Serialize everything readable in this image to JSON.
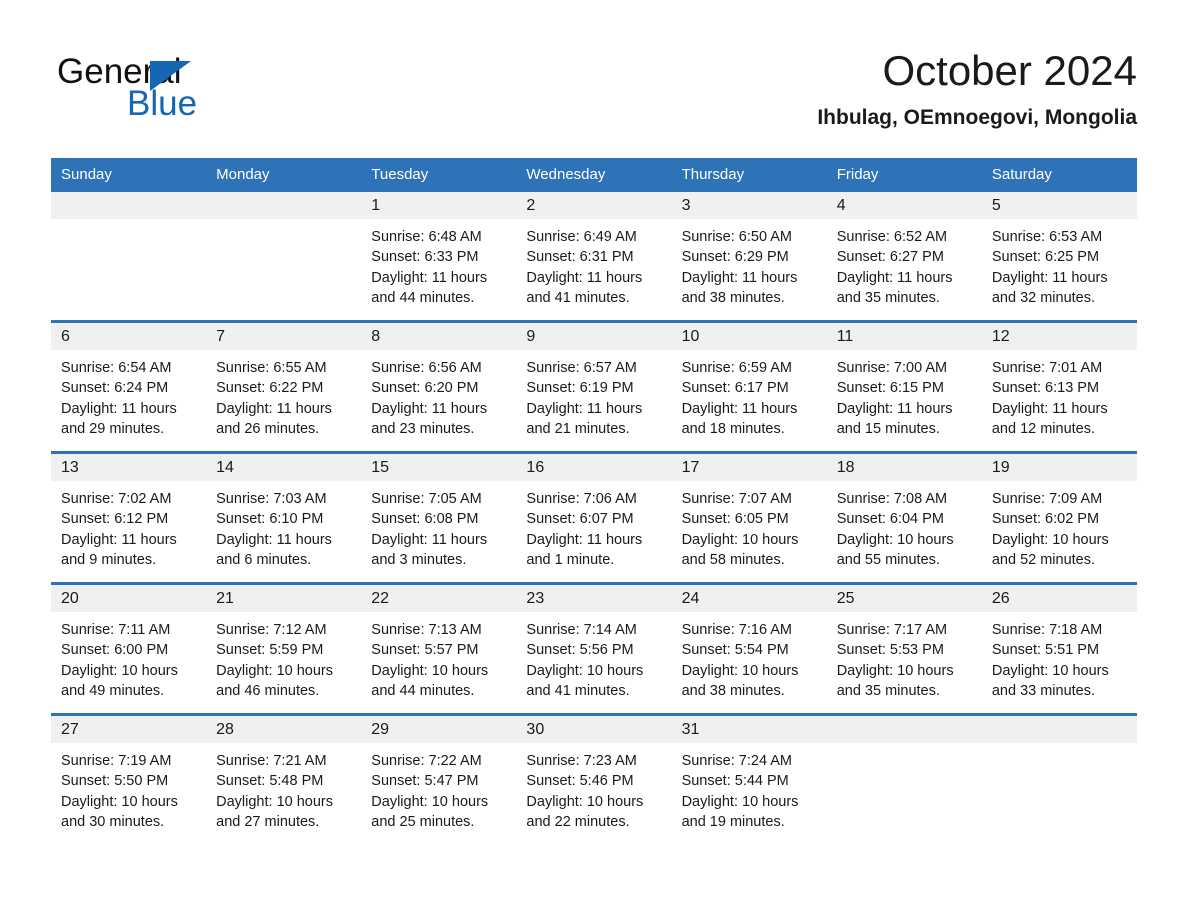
{
  "brand": {
    "name_part1": "General",
    "name_part2": "Blue",
    "logo_icon": "triangle-flag-icon",
    "accent_color": "#1567b2"
  },
  "header": {
    "title": "October 2024",
    "location": "Ihbulag, OEmnoegovi, Mongolia"
  },
  "colors": {
    "header_blue": "#2e73b8",
    "daynum_band": "#f0f0f0",
    "text": "#1a1a1a"
  },
  "calendar": {
    "weekday_headers": [
      "Sunday",
      "Monday",
      "Tuesday",
      "Wednesday",
      "Thursday",
      "Friday",
      "Saturday"
    ],
    "weeks": [
      [
        {
          "day": "",
          "empty": true
        },
        {
          "day": "",
          "empty": true
        },
        {
          "day": "1",
          "sunrise": "Sunrise: 6:48 AM",
          "sunset": "Sunset: 6:33 PM",
          "daylight": "Daylight: 11 hours and 44 minutes."
        },
        {
          "day": "2",
          "sunrise": "Sunrise: 6:49 AM",
          "sunset": "Sunset: 6:31 PM",
          "daylight": "Daylight: 11 hours and 41 minutes."
        },
        {
          "day": "3",
          "sunrise": "Sunrise: 6:50 AM",
          "sunset": "Sunset: 6:29 PM",
          "daylight": "Daylight: 11 hours and 38 minutes."
        },
        {
          "day": "4",
          "sunrise": "Sunrise: 6:52 AM",
          "sunset": "Sunset: 6:27 PM",
          "daylight": "Daylight: 11 hours and 35 minutes."
        },
        {
          "day": "5",
          "sunrise": "Sunrise: 6:53 AM",
          "sunset": "Sunset: 6:25 PM",
          "daylight": "Daylight: 11 hours and 32 minutes."
        }
      ],
      [
        {
          "day": "6",
          "sunrise": "Sunrise: 6:54 AM",
          "sunset": "Sunset: 6:24 PM",
          "daylight": "Daylight: 11 hours and 29 minutes."
        },
        {
          "day": "7",
          "sunrise": "Sunrise: 6:55 AM",
          "sunset": "Sunset: 6:22 PM",
          "daylight": "Daylight: 11 hours and 26 minutes."
        },
        {
          "day": "8",
          "sunrise": "Sunrise: 6:56 AM",
          "sunset": "Sunset: 6:20 PM",
          "daylight": "Daylight: 11 hours and 23 minutes."
        },
        {
          "day": "9",
          "sunrise": "Sunrise: 6:57 AM",
          "sunset": "Sunset: 6:19 PM",
          "daylight": "Daylight: 11 hours and 21 minutes."
        },
        {
          "day": "10",
          "sunrise": "Sunrise: 6:59 AM",
          "sunset": "Sunset: 6:17 PM",
          "daylight": "Daylight: 11 hours and 18 minutes."
        },
        {
          "day": "11",
          "sunrise": "Sunrise: 7:00 AM",
          "sunset": "Sunset: 6:15 PM",
          "daylight": "Daylight: 11 hours and 15 minutes."
        },
        {
          "day": "12",
          "sunrise": "Sunrise: 7:01 AM",
          "sunset": "Sunset: 6:13 PM",
          "daylight": "Daylight: 11 hours and 12 minutes."
        }
      ],
      [
        {
          "day": "13",
          "sunrise": "Sunrise: 7:02 AM",
          "sunset": "Sunset: 6:12 PM",
          "daylight": "Daylight: 11 hours and 9 minutes."
        },
        {
          "day": "14",
          "sunrise": "Sunrise: 7:03 AM",
          "sunset": "Sunset: 6:10 PM",
          "daylight": "Daylight: 11 hours and 6 minutes."
        },
        {
          "day": "15",
          "sunrise": "Sunrise: 7:05 AM",
          "sunset": "Sunset: 6:08 PM",
          "daylight": "Daylight: 11 hours and 3 minutes."
        },
        {
          "day": "16",
          "sunrise": "Sunrise: 7:06 AM",
          "sunset": "Sunset: 6:07 PM",
          "daylight": "Daylight: 11 hours and 1 minute."
        },
        {
          "day": "17",
          "sunrise": "Sunrise: 7:07 AM",
          "sunset": "Sunset: 6:05 PM",
          "daylight": "Daylight: 10 hours and 58 minutes."
        },
        {
          "day": "18",
          "sunrise": "Sunrise: 7:08 AM",
          "sunset": "Sunset: 6:04 PM",
          "daylight": "Daylight: 10 hours and 55 minutes."
        },
        {
          "day": "19",
          "sunrise": "Sunrise: 7:09 AM",
          "sunset": "Sunset: 6:02 PM",
          "daylight": "Daylight: 10 hours and 52 minutes."
        }
      ],
      [
        {
          "day": "20",
          "sunrise": "Sunrise: 7:11 AM",
          "sunset": "Sunset: 6:00 PM",
          "daylight": "Daylight: 10 hours and 49 minutes."
        },
        {
          "day": "21",
          "sunrise": "Sunrise: 7:12 AM",
          "sunset": "Sunset: 5:59 PM",
          "daylight": "Daylight: 10 hours and 46 minutes."
        },
        {
          "day": "22",
          "sunrise": "Sunrise: 7:13 AM",
          "sunset": "Sunset: 5:57 PM",
          "daylight": "Daylight: 10 hours and 44 minutes."
        },
        {
          "day": "23",
          "sunrise": "Sunrise: 7:14 AM",
          "sunset": "Sunset: 5:56 PM",
          "daylight": "Daylight: 10 hours and 41 minutes."
        },
        {
          "day": "24",
          "sunrise": "Sunrise: 7:16 AM",
          "sunset": "Sunset: 5:54 PM",
          "daylight": "Daylight: 10 hours and 38 minutes."
        },
        {
          "day": "25",
          "sunrise": "Sunrise: 7:17 AM",
          "sunset": "Sunset: 5:53 PM",
          "daylight": "Daylight: 10 hours and 35 minutes."
        },
        {
          "day": "26",
          "sunrise": "Sunrise: 7:18 AM",
          "sunset": "Sunset: 5:51 PM",
          "daylight": "Daylight: 10 hours and 33 minutes."
        }
      ],
      [
        {
          "day": "27",
          "sunrise": "Sunrise: 7:19 AM",
          "sunset": "Sunset: 5:50 PM",
          "daylight": "Daylight: 10 hours and 30 minutes."
        },
        {
          "day": "28",
          "sunrise": "Sunrise: 7:21 AM",
          "sunset": "Sunset: 5:48 PM",
          "daylight": "Daylight: 10 hours and 27 minutes."
        },
        {
          "day": "29",
          "sunrise": "Sunrise: 7:22 AM",
          "sunset": "Sunset: 5:47 PM",
          "daylight": "Daylight: 10 hours and 25 minutes."
        },
        {
          "day": "30",
          "sunrise": "Sunrise: 7:23 AM",
          "sunset": "Sunset: 5:46 PM",
          "daylight": "Daylight: 10 hours and 22 minutes."
        },
        {
          "day": "31",
          "sunrise": "Sunrise: 7:24 AM",
          "sunset": "Sunset: 5:44 PM",
          "daylight": "Daylight: 10 hours and 19 minutes."
        },
        {
          "day": "",
          "empty": true
        },
        {
          "day": "",
          "empty": true
        }
      ]
    ]
  }
}
